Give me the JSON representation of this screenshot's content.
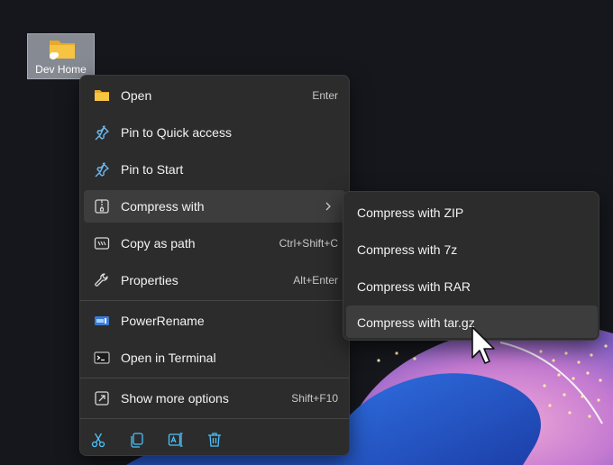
{
  "desktop": {
    "icon_label": "Dev Home",
    "icon": "folder-icon"
  },
  "context_menu": {
    "items": [
      {
        "label": "Open",
        "shortcut": "Enter",
        "icon": "folder-icon"
      },
      {
        "label": "Pin to Quick access",
        "shortcut": "",
        "icon": "pin-icon"
      },
      {
        "label": "Pin to Start",
        "shortcut": "",
        "icon": "pin-icon"
      },
      {
        "label": "Compress with",
        "shortcut": "",
        "icon": "archive-icon",
        "has_submenu": true
      },
      {
        "label": "Copy as path",
        "shortcut": "Ctrl+Shift+C",
        "icon": "copy-path-icon"
      },
      {
        "label": "Properties",
        "shortcut": "Alt+Enter",
        "icon": "wrench-icon"
      },
      {
        "label": "PowerRename",
        "shortcut": "",
        "icon": "powerrename-icon"
      },
      {
        "label": "Open in Terminal",
        "shortcut": "",
        "icon": "terminal-icon"
      },
      {
        "label": "Show more options",
        "shortcut": "Shift+F10",
        "icon": "expand-icon"
      }
    ],
    "quick_actions": [
      "cut-icon",
      "copy-icon",
      "rename-icon",
      "delete-icon"
    ]
  },
  "submenu": {
    "items": [
      {
        "label": "Compress with ZIP"
      },
      {
        "label": "Compress with 7z"
      },
      {
        "label": "Compress with RAR"
      },
      {
        "label": "Compress with tar.gz"
      }
    ],
    "hovered_index": 3
  },
  "colors": {
    "menu_bg": "#2c2c2c",
    "hover_bg": "#3d3d3d",
    "accent": "#4cc2ff",
    "folder": "#f5c23f"
  }
}
